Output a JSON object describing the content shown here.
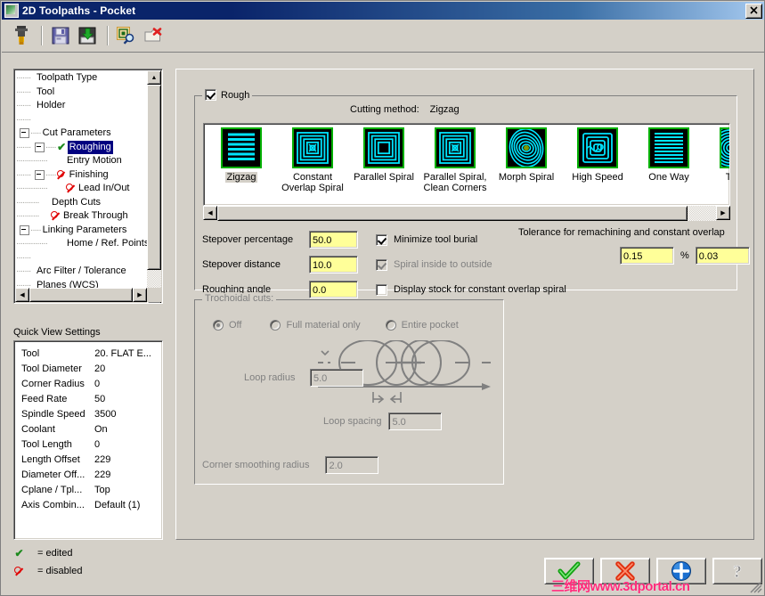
{
  "window": {
    "title": "2D Toolpaths - Pocket",
    "icon": "toolpath-window-icon",
    "close_label": "×"
  },
  "toolbar": {
    "buttons": [
      {
        "name": "tool-endmill-icon",
        "tip": "Tool"
      },
      {
        "name": "save-icon",
        "tip": "Save"
      },
      {
        "name": "save-defaults-icon",
        "tip": "Save to defaults"
      },
      {
        "name": "select-library-icon",
        "tip": "Select from library"
      },
      {
        "name": "delete-entity-icon",
        "tip": "Delete"
      }
    ]
  },
  "tree": {
    "nodes": [
      {
        "label": "Toolpath Type",
        "indent": 1,
        "expander": "none",
        "status": "none",
        "selected": false
      },
      {
        "label": "Tool",
        "indent": 1,
        "expander": "none",
        "status": "none",
        "selected": false
      },
      {
        "label": "Holder",
        "indent": 1,
        "expander": "none",
        "status": "none",
        "selected": false
      },
      {
        "label": "",
        "indent": 1,
        "expander": "none",
        "status": "none",
        "selected": false
      },
      {
        "label": "Cut Parameters",
        "indent": 0,
        "expander": "minus",
        "status": "none",
        "selected": false
      },
      {
        "label": "Roughing",
        "indent": 1,
        "expander": "minus",
        "status": "edited",
        "selected": true
      },
      {
        "label": "Entry Motion",
        "indent": 3,
        "expander": "none",
        "status": "none",
        "selected": false
      },
      {
        "label": "Finishing",
        "indent": 1,
        "expander": "minus",
        "status": "disabled",
        "selected": false
      },
      {
        "label": "Lead In/Out",
        "indent": 3,
        "expander": "none",
        "status": "disabled",
        "selected": false
      },
      {
        "label": "Depth Cuts",
        "indent": 2,
        "expander": "none",
        "status": "none",
        "selected": false
      },
      {
        "label": "Break Through",
        "indent": 2,
        "expander": "none",
        "status": "disabled",
        "selected": false
      },
      {
        "label": "Linking Parameters",
        "indent": 0,
        "expander": "minus",
        "status": "none",
        "selected": false
      },
      {
        "label": "Home / Ref. Points",
        "indent": 3,
        "expander": "none",
        "status": "none",
        "selected": false
      },
      {
        "label": "",
        "indent": 1,
        "expander": "none",
        "status": "none",
        "selected": false
      },
      {
        "label": "Arc Filter / Tolerance",
        "indent": 1,
        "expander": "none",
        "status": "none",
        "selected": false
      },
      {
        "label": "Planes (WCS)",
        "indent": 1,
        "expander": "none",
        "status": "none",
        "selected": false
      }
    ]
  },
  "quick_view": {
    "title": "Quick View Settings",
    "rows": [
      {
        "key": "Tool",
        "value": "20. FLAT E...",
        "align": "right"
      },
      {
        "key": "Tool Diameter",
        "value": "20",
        "align": "left"
      },
      {
        "key": "Corner Radius",
        "value": "0",
        "align": "left"
      },
      {
        "key": "Feed Rate",
        "value": "50",
        "align": "left"
      },
      {
        "key": "Spindle Speed",
        "value": "3500",
        "align": "left"
      },
      {
        "key": "Coolant",
        "value": "On",
        "align": "left"
      },
      {
        "key": "Tool Length",
        "value": "0",
        "align": "left"
      },
      {
        "key": "Length Offset",
        "value": "229",
        "align": "left"
      },
      {
        "key": "Diameter Off...",
        "value": "229",
        "align": "left"
      },
      {
        "key": "Cplane / Tpl...",
        "value": "Top",
        "align": "left"
      },
      {
        "key": "Axis Combin...",
        "value": "Default (1)",
        "align": "left"
      }
    ]
  },
  "legend": {
    "edited": "= edited",
    "disabled": "= disabled"
  },
  "rough": {
    "group_label": "Rough",
    "checked": true,
    "cutting_method_label": "Cutting method:",
    "cutting_method_value": "Zigzag",
    "methods": [
      {
        "name": "Zigzag",
        "glyph": "zigzag",
        "selected": true
      },
      {
        "name": "Constant\nOverlap Spiral",
        "glyph": "constant-overlap-spiral",
        "selected": false
      },
      {
        "name": "Parallel Spiral",
        "glyph": "parallel-spiral",
        "selected": false
      },
      {
        "name": "Parallel Spiral,\nClean Corners",
        "glyph": "parallel-spiral-clean-corners",
        "selected": false
      },
      {
        "name": "Morph Spiral",
        "glyph": "morph-spiral",
        "selected": false
      },
      {
        "name": "High Speed",
        "glyph": "high-speed",
        "selected": false
      },
      {
        "name": "One Way",
        "glyph": "one-way",
        "selected": false
      },
      {
        "name": "True S",
        "glyph": "true-spiral",
        "selected": false
      }
    ],
    "fields": [
      {
        "label": "Stepover percentage",
        "value": "50.0",
        "disabled": false
      },
      {
        "label": "Stepover distance",
        "value": "10.0",
        "disabled": false
      },
      {
        "label": "Roughing angle",
        "value": "0.0",
        "disabled": false
      }
    ],
    "checks": [
      {
        "label": "Minimize tool burial",
        "checked": true,
        "disabled": false
      },
      {
        "label": "Spiral inside to outside",
        "checked": true,
        "disabled": true
      },
      {
        "label": "Display stock for constant overlap spiral",
        "checked": false,
        "disabled": false
      }
    ],
    "tolerance": {
      "label": "Tolerance for remachining and constant overlap",
      "percent_value": "0.15",
      "percent_symbol": "%",
      "distance_value": "0.03"
    }
  },
  "trochoidal": {
    "group_label": "Trochoidal cuts:",
    "options": [
      {
        "label": "Off",
        "selected": true
      },
      {
        "label": "Full material only",
        "selected": false
      },
      {
        "label": "Entire pocket",
        "selected": false
      }
    ],
    "loop_radius_label": "Loop radius",
    "loop_radius_value": "5.0",
    "loop_spacing_label": "Loop spacing",
    "loop_spacing_value": "5.0",
    "corner_smoothing_label": "Corner smoothing radius",
    "corner_smoothing_value": "2.0"
  },
  "actions": [
    {
      "name": "ok-button",
      "icon": "green-check-icon"
    },
    {
      "name": "cancel-button",
      "icon": "red-x-icon"
    },
    {
      "name": "apply-button",
      "icon": "blue-plus-icon"
    },
    {
      "name": "help-button",
      "icon": "question-mark-icon"
    }
  ],
  "watermark": "三维网www.3dportal.cn",
  "colors": {
    "titlebar": "#0a246a",
    "face": "#d4d0c8",
    "field": "#ffff99",
    "selection": "#000080",
    "edited": "#1e8a1e",
    "disabled_icon": "#e00000",
    "icon_green": "#00b000",
    "icon_cyan": "#00e5ff"
  }
}
